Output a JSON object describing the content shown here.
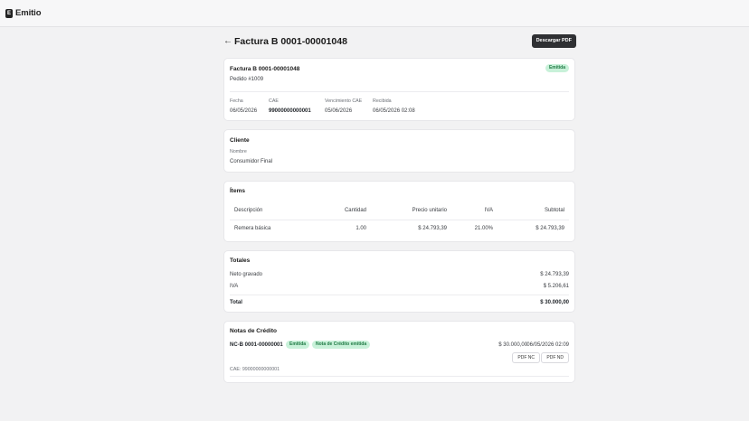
{
  "app": {
    "brand": "Emitio",
    "brand_mark": "E"
  },
  "header": {
    "back_icon": "←",
    "title": "Factura B 0001-00001048",
    "download_label": "Descargar PDF"
  },
  "summary": {
    "title": "Factura B 0001-00001048",
    "order": "Pedido #1009",
    "status": "Emitida",
    "fields": [
      {
        "label": "Fecha",
        "value": "06/05/2026"
      },
      {
        "label": "CAE",
        "value": "99000000000001"
      },
      {
        "label": "Vencimiento CAE",
        "value": "05/06/2026"
      },
      {
        "label": "Recibida",
        "value": "06/05/2026 02:08"
      }
    ]
  },
  "client": {
    "heading": "Cliente",
    "name_label": "Nombre",
    "name_value": "Consumidor Final"
  },
  "items": {
    "heading": "Ítems",
    "columns": [
      "Descripción",
      "Cantidad",
      "Precio unitario",
      "IVA",
      "Subtotal"
    ],
    "rows": [
      [
        "Remera básica",
        "1.00",
        "$ 24.793,39",
        "21.00%",
        "$ 24.793,39"
      ]
    ]
  },
  "totals": {
    "heading": "Totales",
    "net_label": "Neto gravado",
    "net_value": "$ 24.793,39",
    "iva_label": "IVA",
    "iva_value": "$ 5.206,61",
    "total_label": "Total",
    "total_value": "$ 30.000,00"
  },
  "credit_notes": {
    "heading": "Notas de Crédito",
    "number": "NC-B 0001-00000001",
    "badge_status": "Emitida",
    "badge_type": "Nota de Crédito emitida",
    "amount": "$ 30.000,00",
    "date": "06/05/2026 02:09",
    "pdf_nc_label": "PDF NC",
    "pdf_nd_label": "PDF ND",
    "cae": "CAE: 99000000000001"
  }
}
